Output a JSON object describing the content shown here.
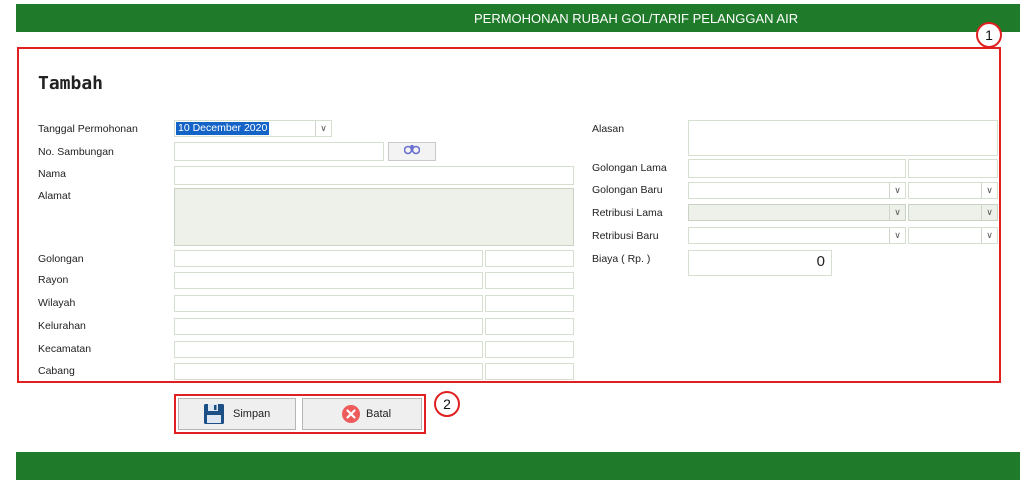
{
  "header": {
    "title": "PERMOHONAN RUBAH GOL/TARIF PELANGGAN AIR"
  },
  "form": {
    "heading": "Tambah",
    "left": {
      "tanggal_label": "Tanggal Permohonan",
      "tanggal_value": "10 December 2020",
      "sambungan_label": "No. Sambungan",
      "nama_label": "Nama",
      "alamat_label": "Alamat",
      "golongan_label": "Golongan",
      "rayon_label": "Rayon",
      "wilayah_label": "Wilayah",
      "kelurahan_label": "Kelurahan",
      "kecamatan_label": "Kecamatan",
      "cabang_label": "Cabang"
    },
    "right": {
      "alasan_label": "Alasan",
      "golongan_lama_label": "Golongan Lama",
      "golongan_baru_label": "Golongan Baru",
      "retribusi_lama_label": "Retribusi Lama",
      "retribusi_baru_label": "Retribusi Baru",
      "biaya_label": "Biaya ( Rp. )",
      "biaya_value": "0"
    }
  },
  "buttons": {
    "simpan": "Simpan",
    "batal": "Batal"
  },
  "callouts": {
    "one": "1",
    "two": "2"
  },
  "icons": {
    "find": "binoculars-icon",
    "save": "floppy-disk-icon",
    "cancel": "close-circle-icon",
    "dropdown": "chevron-down-icon"
  },
  "colors": {
    "header": "#1f7a2a",
    "annotation": "#e02020",
    "selection": "#1463c7"
  }
}
